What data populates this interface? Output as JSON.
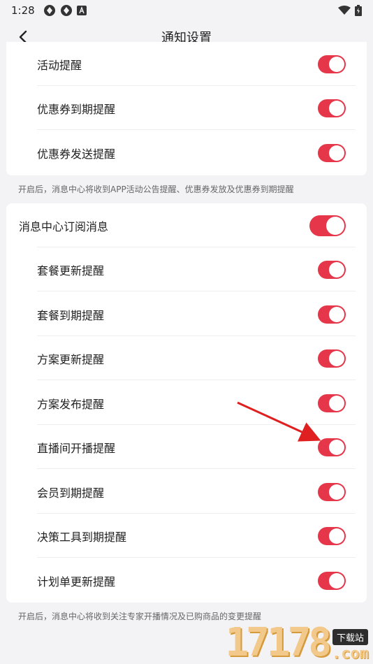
{
  "status_bar": {
    "time": "1:28",
    "left_icons": [
      "app-icon",
      "app-icon",
      "a-icon"
    ],
    "right_icons": [
      "wifi-icon",
      "battery-icon"
    ]
  },
  "nav": {
    "title": "通知设置",
    "back_icon": "chevron-left-icon"
  },
  "section1": {
    "items": [
      {
        "label": "活动提醒",
        "on": true
      },
      {
        "label": "优惠券到期提醒",
        "on": true
      },
      {
        "label": "优惠券发送提醒",
        "on": true
      }
    ],
    "note": "开启后，消息中心将收到APP活动公告提醒、优惠券发放及优惠券到期提醒"
  },
  "section2": {
    "master": {
      "label": "消息中心订阅消息",
      "on": true
    },
    "items": [
      {
        "label": "套餐更新提醒",
        "on": true
      },
      {
        "label": "套餐到期提醒",
        "on": true
      },
      {
        "label": "方案更新提醒",
        "on": true
      },
      {
        "label": "方案发布提醒",
        "on": true
      },
      {
        "label": "直播间开播提醒",
        "on": true
      },
      {
        "label": "会员到期提醒",
        "on": true
      },
      {
        "label": "决策工具到期提醒",
        "on": true
      },
      {
        "label": "计划单更新提醒",
        "on": true
      }
    ],
    "note": "开启后，消息中心将收到关注专家开播情况及已购商品的变更提醒"
  },
  "watermark": {
    "number": "17178",
    "badge": "下载站",
    "domain": ".com"
  },
  "colors": {
    "accent": "#e5364a",
    "background": "#f3f3f5",
    "card": "#ffffff",
    "annotation_arrow": "#e02020"
  }
}
